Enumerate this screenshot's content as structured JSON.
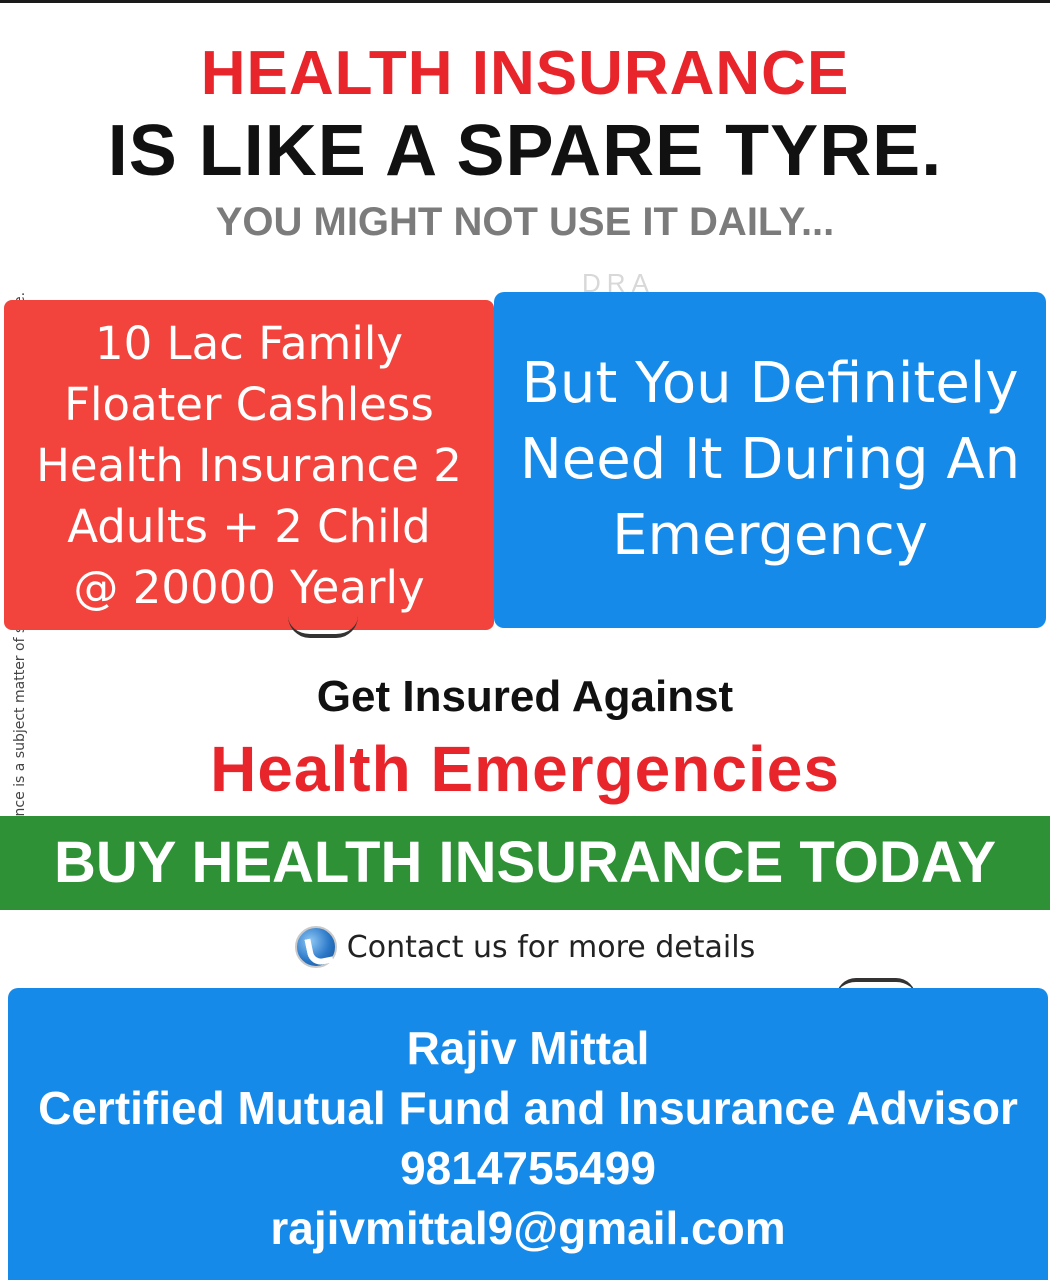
{
  "side_note": "Insurance is a subject matter of solicitation. For education & awareness purpose.",
  "headline": {
    "line1": "HEALTH INSURANCE",
    "line2": "IS LIKE A SPARE TYRE.",
    "sub": "YOU MIGHT NOT USE IT DAILY...",
    "watermark": "DRA"
  },
  "offer_card": {
    "lines": [
      "10 Lac Family",
      "Floater Cashless",
      "Health Insurance 2",
      "Adults + 2 Child",
      "@ 20000 Yearly"
    ]
  },
  "emergency_card": {
    "lines": [
      "But You Definitely",
      "Need It During An",
      "Emergency"
    ]
  },
  "tagline": {
    "line1": "Get Insured Against",
    "line2": "Health Emergencies"
  },
  "cta_band": "BUY HEALTH INSURANCE TODAY",
  "contact": {
    "icon": "phone-icon",
    "text": "Contact us for more details"
  },
  "advisor": {
    "name": "Rajiv Mittal",
    "title": "Certified Mutual Fund and Insurance Advisor",
    "phone": "9814755499",
    "email": "rajivmittal9@gmail.com"
  },
  "colors": {
    "red": "#e8252b",
    "card_red": "#f2443c",
    "blue": "#168ae9",
    "green": "#2e9136",
    "gray": "#7b7b7b"
  }
}
